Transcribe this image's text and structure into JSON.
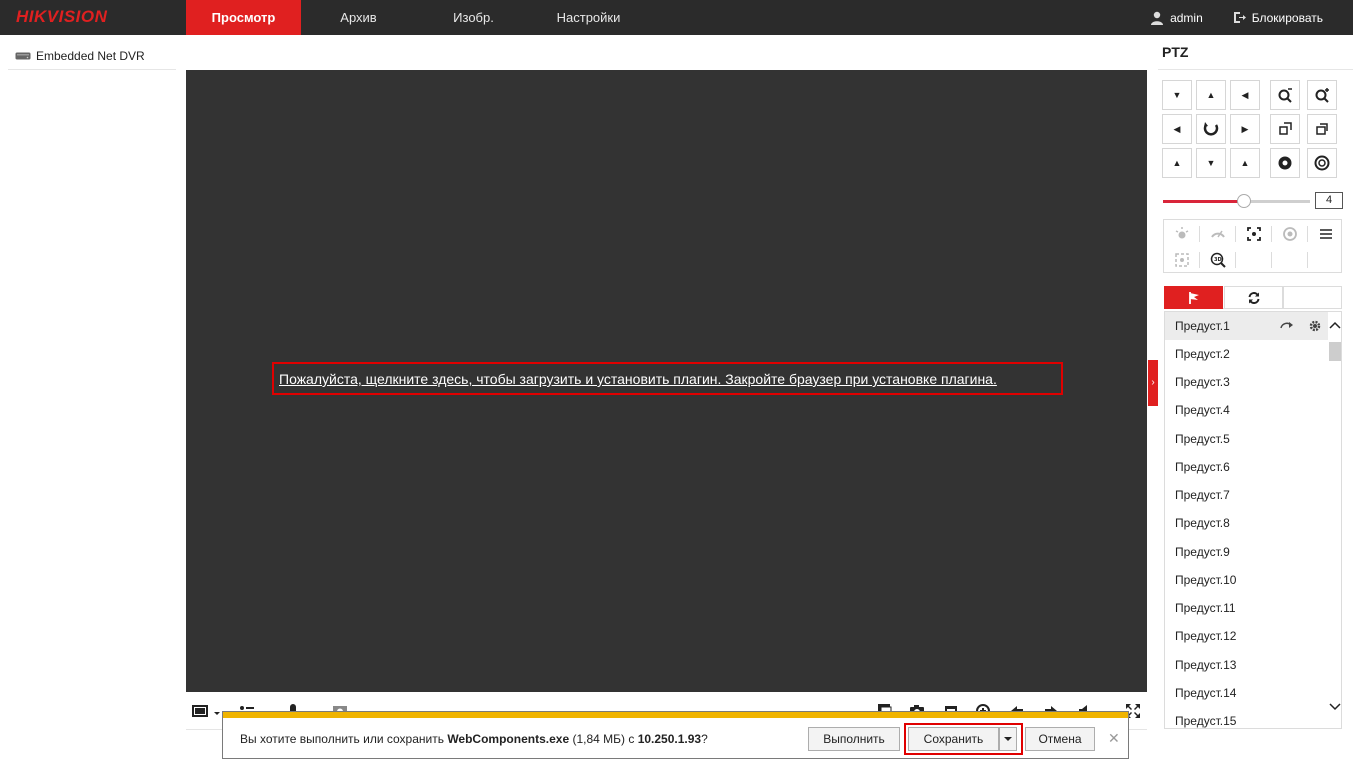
{
  "app": {
    "logo": "HIKVISION"
  },
  "nav": {
    "items": [
      "Просмотр",
      "Архив",
      "Изобр.",
      "Настройки"
    ],
    "active_index": 0
  },
  "user": {
    "name": "admin",
    "lock_label": "Блокировать"
  },
  "device_tree": {
    "device_name": "Embedded Net DVR"
  },
  "video": {
    "plugin_message": "Пожалуйста, щелкните здесь, чтобы загрузить и установить плагин. Закройте браузер при установке плагина."
  },
  "ptz": {
    "title": "PTZ",
    "speed_value": "4",
    "speed_fraction": 0.55,
    "presets": [
      "Предуст.1",
      "Предуст.2",
      "Предуст.3",
      "Предуст.4",
      "Предуст.5",
      "Предуст.6",
      "Предуст.7",
      "Предуст.8",
      "Предуст.9",
      "Предуст.10",
      "Предуст.11",
      "Предуст.12",
      "Предуст.13",
      "Предуст.14",
      "Предуст.15"
    ],
    "selected_preset_index": 0
  },
  "download_bar": {
    "text_before": "Вы хотите выполнить или сохранить ",
    "file_name": "WebComponents.exe",
    "text_middle": " (1,84 МБ) с ",
    "host": "10.250.1.93",
    "text_after": "?",
    "run_label": "Выполнить",
    "save_label": "Сохранить",
    "cancel_label": "Отмена"
  },
  "colors": {
    "accent": "#e02020",
    "topbar": "#2b2b2b",
    "video_bg": "#333333",
    "notification_stripe": "#f0b400"
  }
}
